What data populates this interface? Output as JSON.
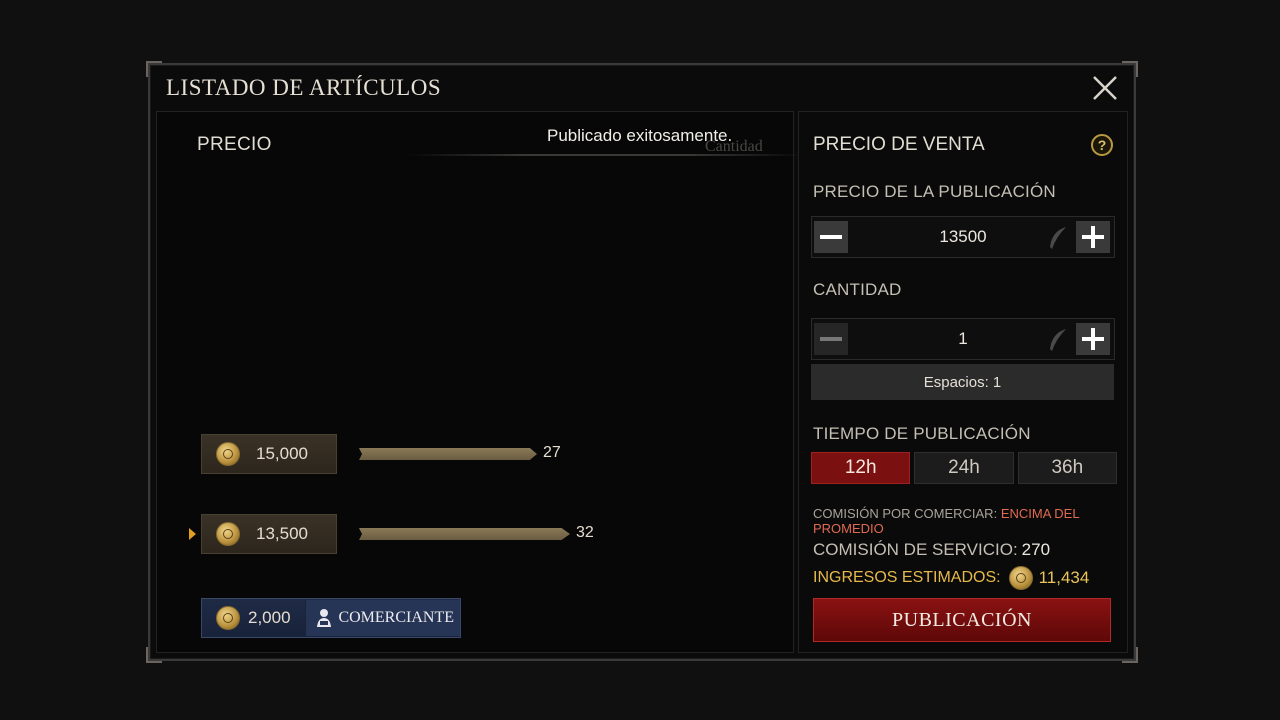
{
  "modal": {
    "title": "LISTADO DE ARTÍCULOS"
  },
  "left": {
    "price_header": "PRECIO",
    "quantity_header": "Cantidad",
    "toast": "Publicado exitosamente.",
    "listings": [
      {
        "price": "15,000",
        "count": "27",
        "selected": false
      },
      {
        "price": "13,500",
        "count": "32",
        "selected": true
      }
    ],
    "merchant": {
      "price": "2,000",
      "label": "COMERCIANTE"
    }
  },
  "right": {
    "title": "PRECIO DE VENTA",
    "help": "?",
    "listing_price_label": "PRECIO DE LA PUBLICACIÓN",
    "listing_price_value": "13500",
    "quantity_label": "CANTIDAD",
    "quantity_value": "1",
    "slots": "Espacios: 1",
    "duration_label": "TIEMPO DE PUBLICACIÓN",
    "duration_options": [
      "12h",
      "24h",
      "36h"
    ],
    "duration_selected": "12h",
    "trade_fee_label": "COMISIÓN POR COMERCIAR:",
    "trade_fee_value": "ENCIMA DEL PROMEDIO",
    "service_fee_label": "COMISIÓN DE SERVICIO:",
    "service_fee_value": "270",
    "income_label": "INGRESOS ESTIMADOS:",
    "income_value": "11,434",
    "publish_label": "PUBLICACIÓN"
  },
  "colors": {
    "accent_red": "#7a1010",
    "gold": "#e6b94a",
    "warning": "#e06a52",
    "merchant_blue": "#263556"
  },
  "icons": [
    "close-icon",
    "help-icon",
    "gold-coin-icon",
    "quill-icon",
    "merchant-icon",
    "minus-icon",
    "plus-icon"
  ]
}
